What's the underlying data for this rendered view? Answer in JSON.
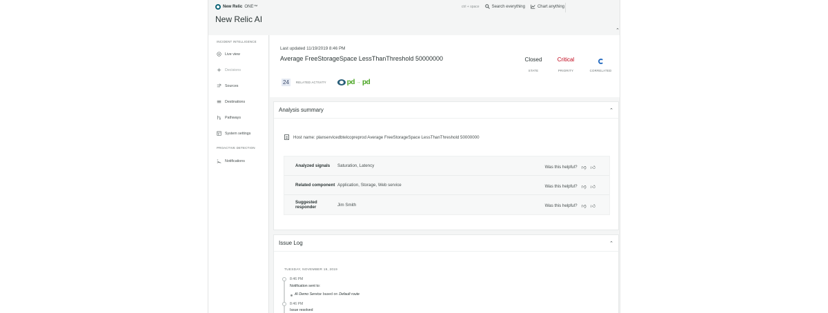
{
  "header": {
    "logo_name": "New Relic",
    "logo_suffix": "ONE™",
    "app_title": "New Relic AI",
    "shortcut": "ctrl + space",
    "search_label": "Search everything",
    "chart_label": "Chart anything"
  },
  "sidebar": {
    "section_incident": "INCIDENT INTELLIGENCE",
    "section_proactive": "PROACTIVE DETECTION",
    "items": [
      {
        "label": "Live view",
        "icon": "live-view-icon"
      },
      {
        "label": "Decisions",
        "icon": "decisions-icon"
      },
      {
        "label": "Sources",
        "icon": "sources-icon"
      },
      {
        "label": "Destinations",
        "icon": "destinations-icon"
      },
      {
        "label": "Pathways",
        "icon": "pathways-icon"
      },
      {
        "label": "System settings",
        "icon": "settings-icon"
      },
      {
        "label": "Notifications",
        "icon": "notifications-icon"
      }
    ]
  },
  "incident": {
    "last_updated": "Last updated 11/19/2019 8:46 PM",
    "title": "Average FreeStorageSpace LessThanThreshold 50000000",
    "related_count": "24",
    "related_label": "RELATED ACTIVITY",
    "pd_source": "pd",
    "pd_destination": "pd",
    "state_value": "Closed",
    "state_label": "STATE",
    "priority_value": "Critical",
    "priority_label": "PRIORITY",
    "correlated_label": "CORRELATED",
    "priority_color": "#bf0016"
  },
  "analysis": {
    "title": "Analysis summary",
    "host_line": "Host name: planservicedbtelcopreprod Average FreeStorageSpace LessThanThreshold 50000000",
    "rows": [
      {
        "key": "Analyzed signals",
        "value": "Saturation, Latency",
        "helpful": "Was this helpful?"
      },
      {
        "key": "Related component",
        "value": "Application, Storage, Web service",
        "helpful": "Was this helpful?"
      },
      {
        "key": "Suggested responder",
        "value": "Jim Smith",
        "helpful": "Was this helpful?"
      }
    ]
  },
  "issue_log": {
    "title": "Issue Log",
    "date": "TUESDAY, NOVEMBER 19, 2019",
    "entry1_time": "8:46 PM",
    "entry1_text": "Notification sent to:",
    "entry1_service": "AI Demo Service",
    "entry1_based": "based on",
    "entry1_route": "Default route",
    "entry2_time": "8:46 PM",
    "entry2_text": "Issue resolved"
  }
}
